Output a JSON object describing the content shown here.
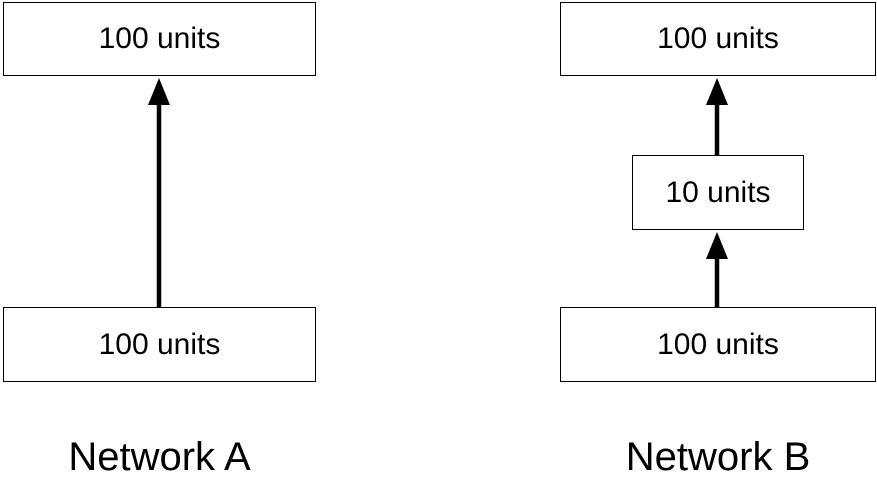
{
  "network_a": {
    "label": "Network A",
    "top_layer": "100 units",
    "bottom_layer": "100 units"
  },
  "network_b": {
    "label": "Network B",
    "top_layer": "100 units",
    "middle_layer": "10 units",
    "bottom_layer": "100 units"
  },
  "colors": {
    "stroke": "#000000",
    "background": "#ffffff"
  }
}
